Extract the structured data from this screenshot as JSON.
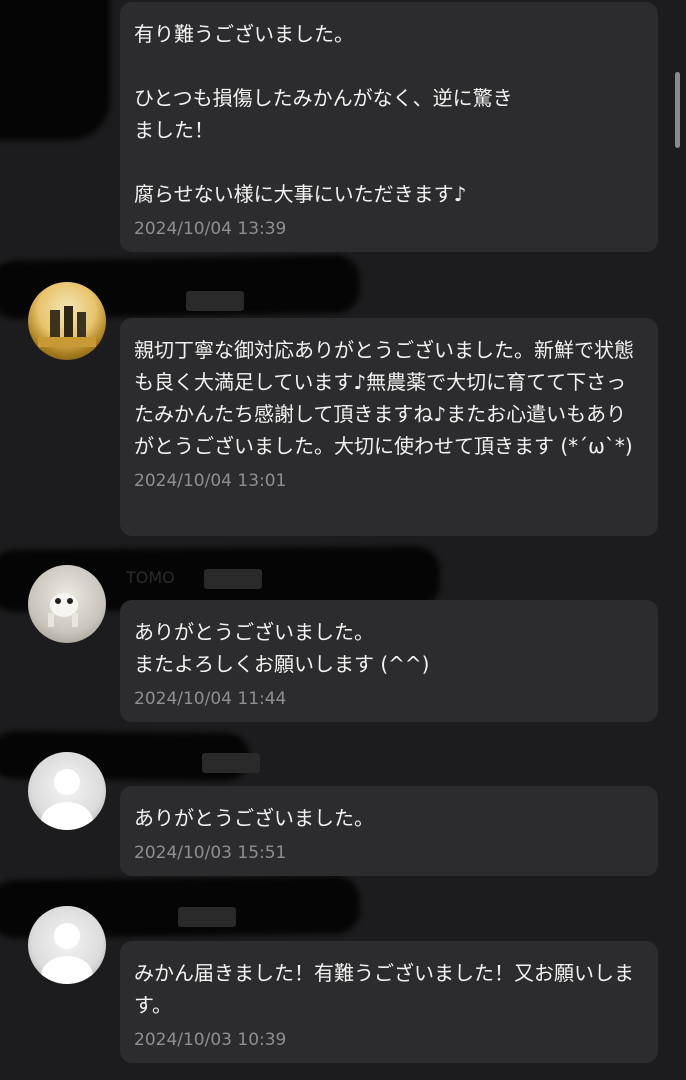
{
  "messages": [
    {
      "text": "有り難うございました。\n\nひとつも損傷したみかんがなく、逆に驚き\nました！\n\n腐らせない様に大事にいただきます♪",
      "timestamp": "2024/10/04 13:39"
    },
    {
      "name": "",
      "text": "親切丁寧な御対応ありがとうございました。新鮮で状態も良く大満足しています♪無農薬で大切に育てて下さったみかんたち感謝して頂きますね♪またお心遣いもありがとうございました。大切に使わせて頂きます (*´ω`*)",
      "timestamp": "2024/10/04 13:01"
    },
    {
      "name": "TOMO",
      "text": "ありがとうございました。\nまたよろしくお願いします (^^)",
      "timestamp": "2024/10/04 11:44"
    },
    {
      "name": "",
      "text": "ありがとうございました。",
      "timestamp": "2024/10/03 15:51"
    },
    {
      "name": "",
      "text": "みかん届きました！有難うございました！又お願いします。",
      "timestamp": "2024/10/03 10:39"
    }
  ]
}
